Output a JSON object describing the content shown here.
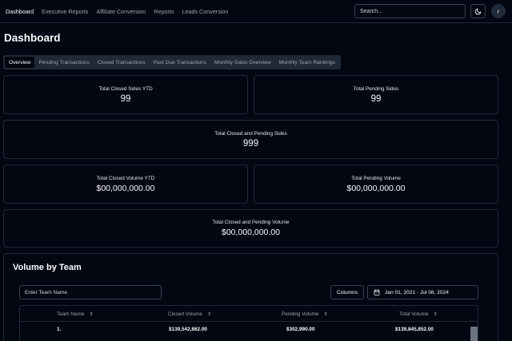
{
  "nav": {
    "items": [
      "Dashboard",
      "Executive Reports",
      "Affiliate Conversion",
      "Reports",
      "Leads Conversion"
    ],
    "search_placeholder": "Search...",
    "avatar_initial": "r"
  },
  "page": {
    "title": "Dashboard"
  },
  "tabs": [
    "Overview",
    "Pending Transactions",
    "Closed Transactions",
    "Past Due Transactions",
    "Monthly Sales Overview",
    "Monthly Team Rankings"
  ],
  "cards": {
    "closed_sides": {
      "label": "Total Closed Sides YTD",
      "value": "99"
    },
    "pending_sides": {
      "label": "Total Pending Sides",
      "value": "99"
    },
    "closed_pending_sides": {
      "label": "Total Closed and Pending Sides",
      "value": "999"
    },
    "closed_volume": {
      "label": "Total Closed Volume YTD",
      "value": "$00,000,000.00"
    },
    "pending_volume": {
      "label": "Total Pending Volume",
      "value": "$00,000,000.00"
    },
    "closed_pending_volume": {
      "label": "Total Closed and Pending Volume",
      "value": "$00,000,000.00"
    }
  },
  "volume": {
    "title": "Volume by Team",
    "team_placeholder": "Enter Team Name",
    "columns_label": "Columns",
    "date_range": "Jan 01, 2021 - Jul 08, 2024",
    "headers": [
      "Team Name",
      "Closed Volume",
      "Pending Volume",
      "Total Volume"
    ],
    "rows": [
      {
        "team": "1.",
        "closed": "$139,542,862.00",
        "pending": "$302,990.00",
        "total": "$139,845,852.00"
      }
    ]
  },
  "colors": {
    "background": "#030712",
    "border": "#1f2937",
    "muted_text": "#9ca3af"
  }
}
